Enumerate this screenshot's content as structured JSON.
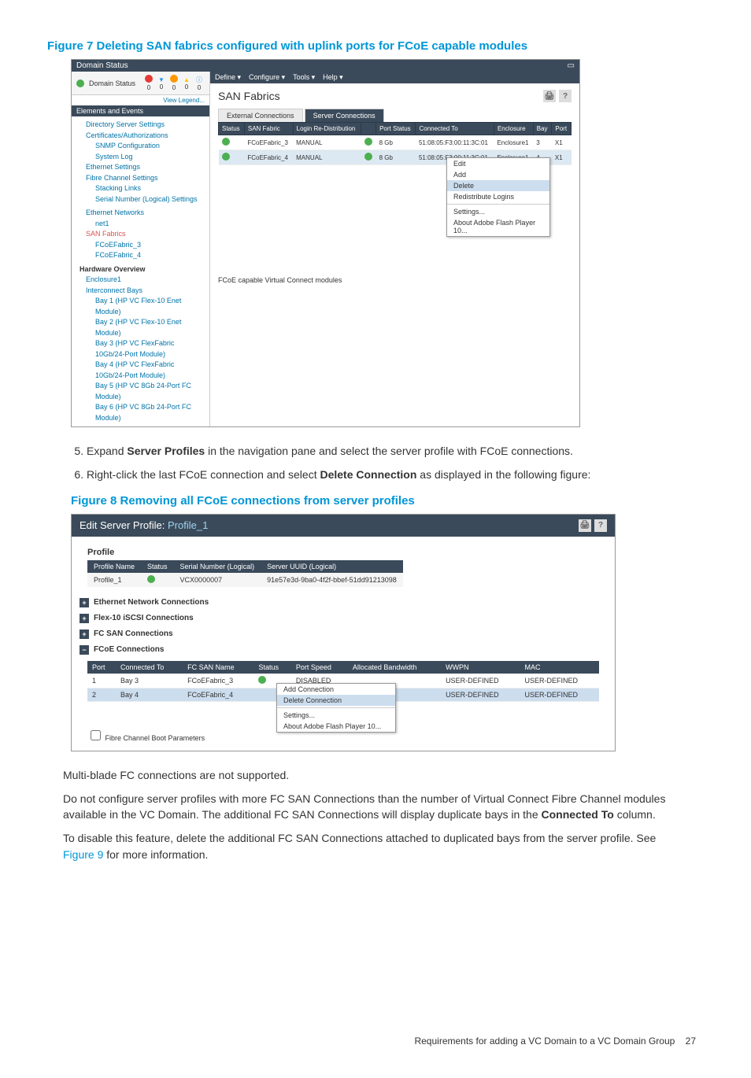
{
  "fig7": {
    "title": "Figure 7 Deleting SAN fabrics configured with uplink ports for FCoE capable modules",
    "titlebar": "Domain Status",
    "menu": [
      "Define ▾",
      "Configure ▾",
      "Tools ▾",
      "Help ▾"
    ],
    "domain_status_label": "Domain Status",
    "view_legend": "View Legend...",
    "elements_hdr": "Elements and Events",
    "status_counts": [
      "0",
      "0",
      "0",
      "0",
      "0"
    ],
    "tree": {
      "dir_server": "Directory Server Settings",
      "cert": "Certificates/Authorizations",
      "snmp": "SNMP Configuration",
      "syslog": "System Log",
      "eth_settings": "Ethernet Settings",
      "fc_settings": "Fibre Channel Settings",
      "stacking": "Stacking Links",
      "serial": "Serial Number (Logical) Settings",
      "eth_net": "Ethernet Networks",
      "net1": "net1",
      "san_fabrics": "SAN Fabrics",
      "fcoe3": "FCoEFabric_3",
      "fcoe4": "FCoEFabric_4",
      "hw_over": "Hardware Overview",
      "enc1": "Enclosure1",
      "ibays": "Interconnect Bays",
      "bay1": "Bay 1 (HP VC Flex-10 Enet Module)",
      "bay2": "Bay 2 (HP VC Flex-10 Enet Module)",
      "bay3": "Bay 3 (HP VC FlexFabric 10Gb/24-Port Module)",
      "bay4": "Bay 4 (HP VC FlexFabric 10Gb/24-Port Module)",
      "bay5": "Bay 5 (HP VC 8Gb 24-Port FC Module)",
      "bay6": "Bay 6 (HP VC 8Gb 24-Port FC Module)"
    },
    "main_title": "SAN Fabrics",
    "tabs": [
      "External Connections",
      "Server Connections"
    ],
    "table": {
      "headers": [
        "Status",
        "SAN Fabric",
        "Login Re-Distribution",
        "",
        "Port Status",
        "Connected To",
        "Enclosure",
        "Bay",
        "Port"
      ],
      "rows": [
        {
          "fabric": "FCoEFabric_3",
          "login": "MANUAL",
          "ps": "8 Gb",
          "conn": "51:08:05:F3:00:11:3C:01",
          "enc": "Enclosure1",
          "bay": "3",
          "port": "X1"
        },
        {
          "fabric": "FCoEFabric_4",
          "login": "MANUAL",
          "ps": "8 Gb",
          "conn": "51:08:05:F3:00:11:3C:01",
          "enc": "Enclosure1",
          "bay": "4",
          "port": "X1"
        }
      ]
    },
    "ctx": {
      "edit": "Edit",
      "add": "Add",
      "delete": "Delete",
      "redist": "Redistribute Logins",
      "settings": "Settings...",
      "flash": "About Adobe Flash Player 10..."
    },
    "footer": "FCoE capable Virtual Connect modules"
  },
  "step5": "Expand Server Profiles in the navigation pane and select the server profile with FCoE connections.",
  "step5_num": "5.",
  "step5_expand": "Expand ",
  "step5_bold": "Server Profiles",
  "step5_rest": " in the navigation pane and select the server profile with FCoE connections.",
  "step6_num": "6.",
  "step6_pre": "Right-click the last FCoE connection and select ",
  "step6_bold": "Delete Connection",
  "step6_post": " as displayed in the following figure:",
  "fig8": {
    "title": "Figure 8 Removing all FCoE connections from server profiles",
    "edit_title": "Edit Server Profile:",
    "profile_name_val": "Profile_1",
    "profile_hdr": "Profile",
    "ptbl_headers": [
      "Profile Name",
      "Status",
      "Serial Number (Logical)",
      "Server UUID (Logical)"
    ],
    "ptbl_row": {
      "name": "Profile_1",
      "serial": "VCX0000007",
      "uuid": "91e57e3d-9ba0-4f2f-bbef-51dd91213098"
    },
    "sections": {
      "eth": "Ethernet Network Connections",
      "iscsi": "Flex-10 iSCSI Connections",
      "fcsan": "FC SAN Connections",
      "fcoe": "FCoE Connections"
    },
    "fcoe_headers": [
      "Port",
      "Connected To",
      "FC SAN Name",
      "Status",
      "Port Speed",
      "Allocated Bandwidth",
      "WWPN",
      "MAC"
    ],
    "fcoe_rows": [
      {
        "port": "1",
        "conn": "Bay 3",
        "name": "FCoEFabric_3",
        "speed": "DISABLED",
        "wwpn": "USER-DEFINED",
        "mac": "USER-DEFINED"
      },
      {
        "port": "2",
        "conn": "Bay 4",
        "name": "FCoEFabric_4",
        "speed": "",
        "wwpn": "USER-DEFINED",
        "mac": "USER-DEFINED"
      }
    ],
    "ctx": {
      "add": "Add Connection",
      "del": "Delete Connection",
      "settings": "Settings...",
      "flash": "About Adobe Flash Player 10..."
    },
    "fc_boot": "Fibre Channel Boot Parameters"
  },
  "p1": "Multi-blade FC connections are not supported.",
  "p2_a": "Do not configure server profiles with more FC SAN Connections than the number of Virtual Connect Fibre Channel modules available in the VC Domain. The additional FC SAN Connections will display duplicate bays in the ",
  "p2_b": "Connected To",
  "p2_c": " column.",
  "p3_a": "To disable this feature, delete the additional FC SAN Connections attached to duplicated bays from the server profile. See ",
  "p3_link": "Figure 9",
  "p3_b": " for more information.",
  "footer_text": "Requirements for adding a VC Domain to a VC Domain Group",
  "footer_page": "27"
}
